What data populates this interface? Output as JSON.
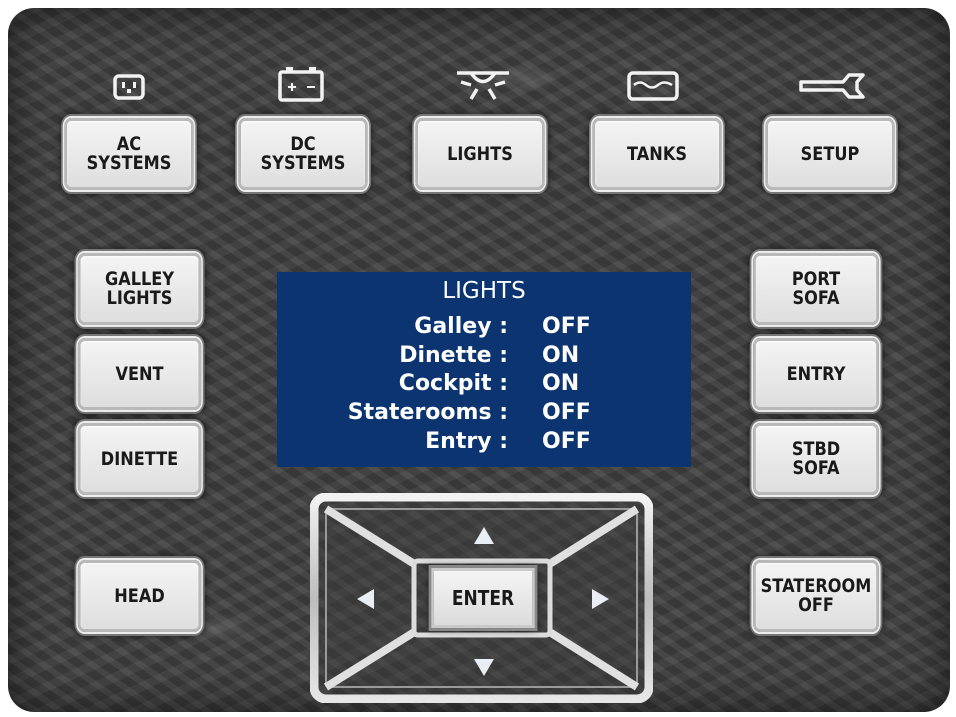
{
  "top_nav": [
    {
      "key": "ac",
      "label": "AC\nSYSTEMS",
      "icon": "outlet-icon"
    },
    {
      "key": "dc",
      "label": "DC\nSYSTEMS",
      "icon": "battery-icon"
    },
    {
      "key": "lights",
      "label": "LIGHTS",
      "icon": "ceiling-light-icon"
    },
    {
      "key": "tanks",
      "label": "TANKS",
      "icon": "tank-icon"
    },
    {
      "key": "setup",
      "label": "SETUP",
      "icon": "wrench-icon"
    }
  ],
  "left_buttons": [
    {
      "label": "GALLEY\nLIGHTS"
    },
    {
      "label": "VENT"
    },
    {
      "label": "DINETTE"
    },
    {
      "label": "HEAD"
    }
  ],
  "right_buttons": [
    {
      "label": "PORT\nSOFA"
    },
    {
      "label": "ENTRY"
    },
    {
      "label": "STBD\nSOFA"
    },
    {
      "label": "STATEROOM\nOFF"
    }
  ],
  "display": {
    "title": "LIGHTS",
    "rows": [
      {
        "label": "Galley :",
        "value": "OFF"
      },
      {
        "label": "Dinette :",
        "value": "ON"
      },
      {
        "label": "Cockpit :",
        "value": "ON"
      },
      {
        "label": "Staterooms :",
        "value": "OFF"
      },
      {
        "label": "Entry :",
        "value": "OFF"
      }
    ]
  },
  "dpad": {
    "enter_label": "ENTER",
    "arrows": [
      "up-arrow-icon",
      "down-arrow-icon",
      "left-arrow-icon",
      "right-arrow-icon"
    ]
  },
  "colors": {
    "panel": "#3f3f3f",
    "display_bg": "#0b3470",
    "display_text": "#ffffff",
    "button_face": "#e8e8e8",
    "button_text": "#1a1a1a",
    "icon": "#f2f2f2"
  }
}
